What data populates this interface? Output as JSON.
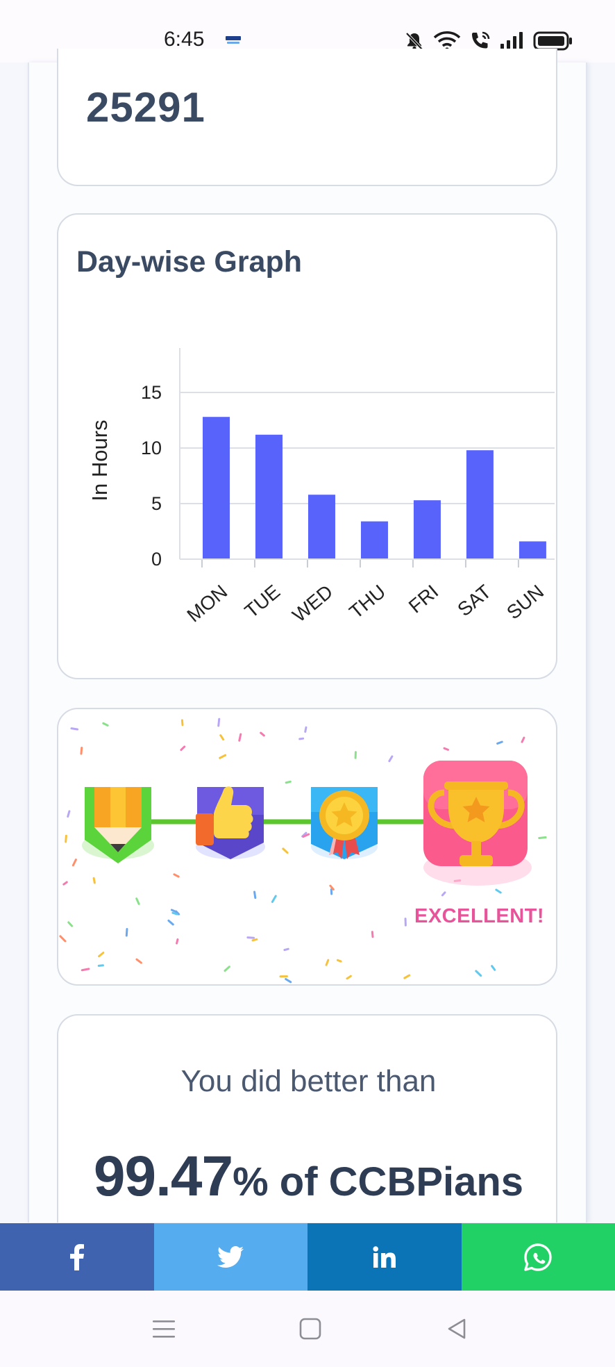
{
  "status_bar": {
    "time": "6:45",
    "icons": [
      "paytm-business-icon",
      "bell-muted-icon",
      "wifi-icon",
      "wifi-call-icon",
      "signal-icon",
      "battery-icon"
    ]
  },
  "score_card": {
    "value": "25291"
  },
  "graph_card": {
    "title": "Day-wise Graph"
  },
  "chart_data": {
    "type": "bar",
    "categories": [
      "MON",
      "TUE",
      "WED",
      "THU",
      "FRI",
      "SAT",
      "SUN"
    ],
    "values": [
      12.8,
      11.2,
      5.8,
      3.4,
      5.3,
      9.8,
      1.6
    ],
    "title": "Day-wise Graph",
    "xlabel": "",
    "ylabel": "In Hours",
    "yticks": [
      0,
      5,
      10,
      15
    ],
    "ylim": [
      0,
      19
    ],
    "grid": true,
    "bar_color": "#5863fb"
  },
  "badges_card": {
    "milestones": [
      "pencil-badge-icon",
      "thumbs-up-badge-icon",
      "medal-badge-icon",
      "trophy-badge-icon"
    ],
    "active_label": "EXCELLENT!"
  },
  "better_card": {
    "label": "You did better than",
    "percentage": "99.47",
    "suffix": "% of CCBPians"
  },
  "share_bar": {
    "buttons": [
      {
        "name": "facebook",
        "icon": "facebook-icon",
        "color": "#4063b0"
      },
      {
        "name": "twitter",
        "icon": "twitter-icon",
        "color": "#55acee"
      },
      {
        "name": "linkedin",
        "icon": "linkedin-icon",
        "color": "#0a74b6"
      },
      {
        "name": "whatsapp",
        "icon": "whatsapp-icon",
        "color": "#21d166"
      }
    ]
  },
  "nav_bar": {
    "buttons": [
      "menu-icon",
      "home-icon",
      "back-icon"
    ]
  }
}
